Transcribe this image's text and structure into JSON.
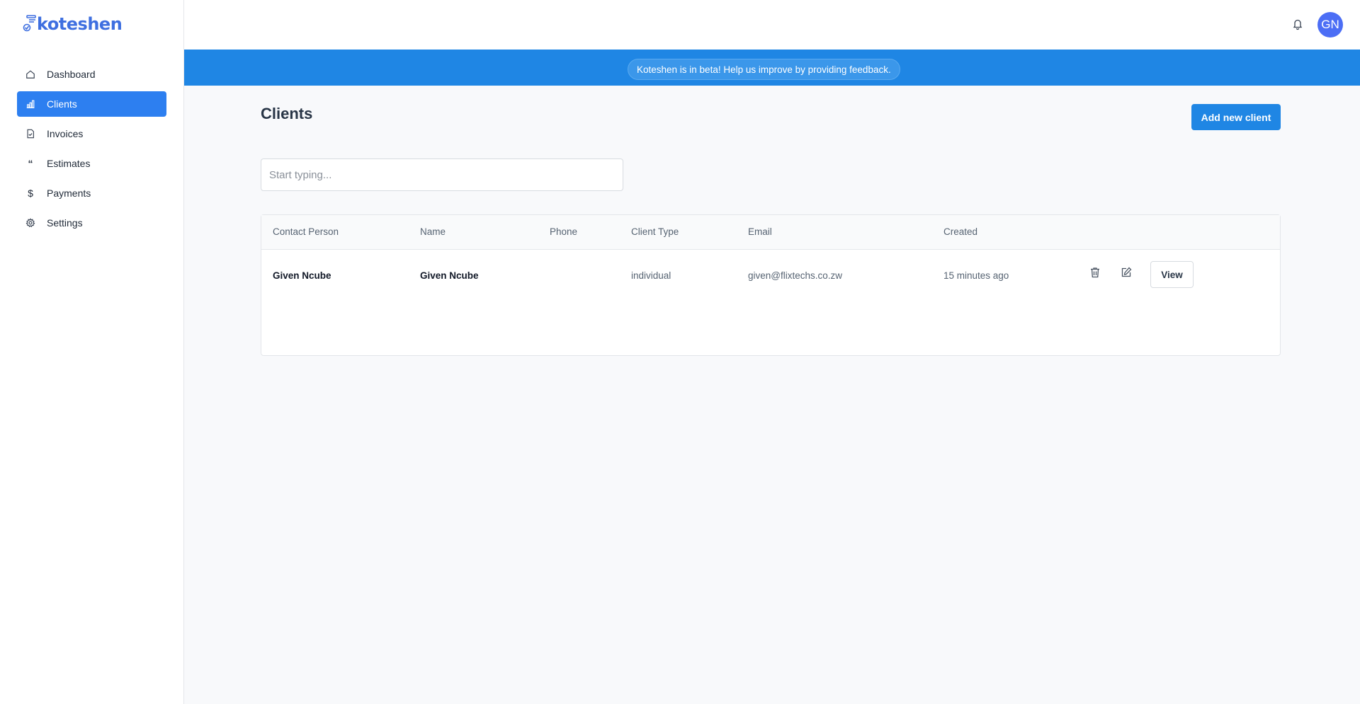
{
  "app": {
    "logo_text": "koteshen",
    "brand_color": "#3e6fe0",
    "accent_color": "#1f86e4"
  },
  "sidebar": {
    "items": [
      {
        "label": "Dashboard",
        "icon": "home-icon",
        "active": false
      },
      {
        "label": "Clients",
        "icon": "bar-chart-icon",
        "active": true
      },
      {
        "label": "Invoices",
        "icon": "document-check-icon",
        "active": false
      },
      {
        "label": "Estimates",
        "icon": "quote-icon",
        "active": false
      },
      {
        "label": "Payments",
        "icon": "dollar-icon",
        "active": false
      },
      {
        "label": "Settings",
        "icon": "gear-icon",
        "active": false
      }
    ]
  },
  "header": {
    "avatar_initials": "GN",
    "notification_icon": "bell-icon"
  },
  "banner": {
    "text": "Koteshen is in beta! Help us improve by providing feedback."
  },
  "main": {
    "title": "Clients",
    "add_button_label": "Add new client",
    "search": {
      "placeholder": "Start typing...",
      "value": ""
    },
    "table": {
      "columns": [
        "Contact Person",
        "Name",
        "Phone",
        "Client Type",
        "Email",
        "Created"
      ],
      "rows": [
        {
          "contact_person": "Given Ncube",
          "name": "Given Ncube",
          "phone": "",
          "client_type": "individual",
          "email": "given@flixtechs.co.zw",
          "created": "15 minutes ago",
          "view_label": "View"
        }
      ]
    }
  }
}
